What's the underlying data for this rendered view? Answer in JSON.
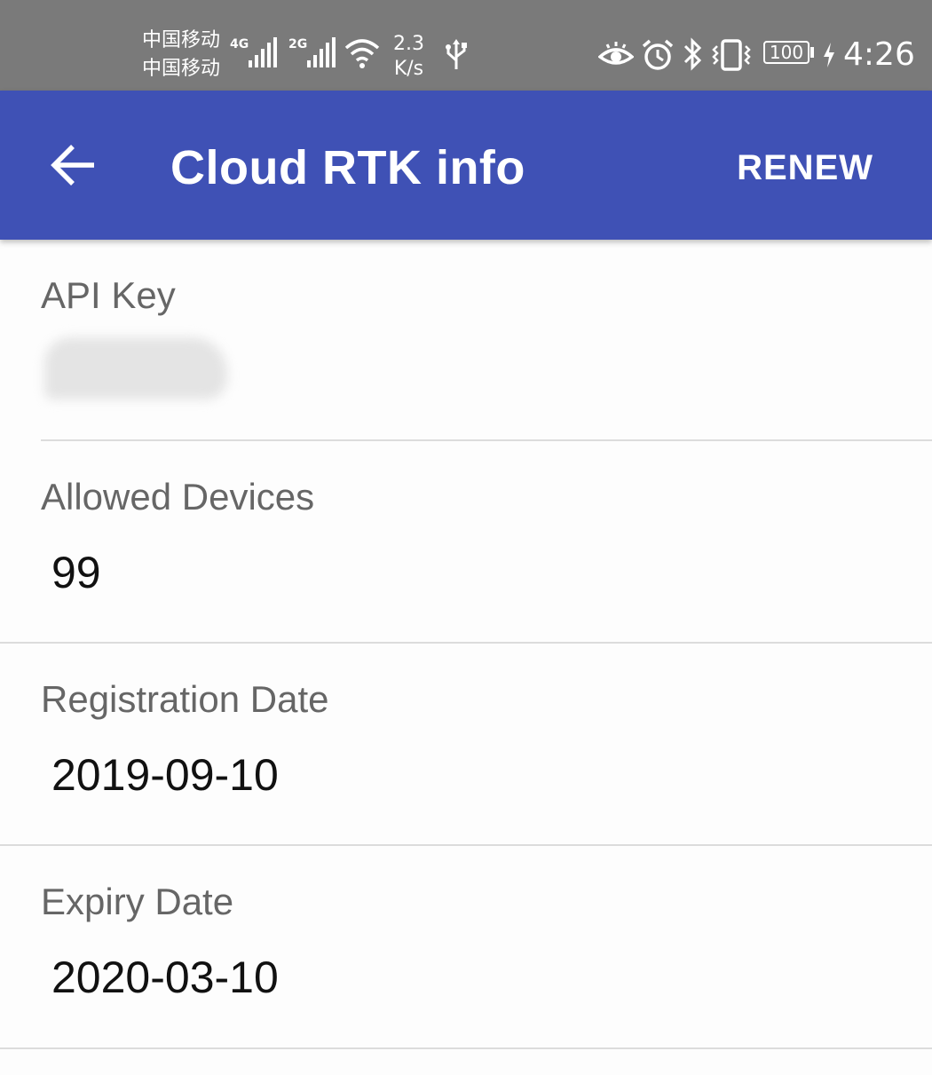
{
  "status_bar": {
    "carrier_1": "中国移动",
    "carrier_2": "中国移动",
    "network_1": "4G",
    "network_2": "2G",
    "speed_value": "2.3",
    "speed_unit": "K/s",
    "battery": "100",
    "time": "4:26",
    "icons": [
      "signal-icon",
      "wifi-icon",
      "usb-icon",
      "eye-icon",
      "alarm-icon",
      "bluetooth-icon",
      "vibrate-icon",
      "battery-icon",
      "charging-icon"
    ]
  },
  "app_bar": {
    "title": "Cloud RTK info",
    "action": "RENEW",
    "color": "#3f51b5"
  },
  "info": {
    "api_key": {
      "label": "API Key",
      "value": ""
    },
    "allowed_devices": {
      "label": "Allowed Devices",
      "value": "99"
    },
    "registration_date": {
      "label": "Registration Date",
      "value": "2019-09-10"
    },
    "expiry_date": {
      "label": "Expiry Date",
      "value": "2020-03-10"
    }
  }
}
